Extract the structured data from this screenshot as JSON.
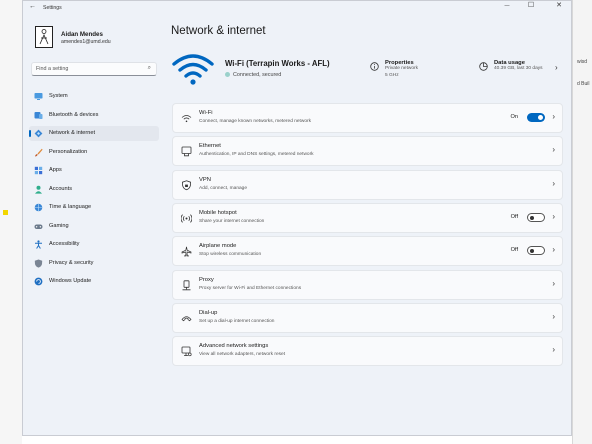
{
  "window": {
    "title": "Settings",
    "back_glyph": "←",
    "minimize_glyph": "—",
    "maximize_glyph": "☐",
    "close_glyph": "✕"
  },
  "profile": {
    "name": "Aidan Mendes",
    "email": "amendes1@umd.edu"
  },
  "search": {
    "placeholder": "Find a setting",
    "value": ""
  },
  "nav": {
    "selected": "Network & internet",
    "items": [
      {
        "label": "System",
        "icon": "monitor-icon"
      },
      {
        "label": "Bluetooth & devices",
        "icon": "bluetooth-devices-icon"
      },
      {
        "label": "Network & internet",
        "icon": "network-diamond-icon"
      },
      {
        "label": "Personalization",
        "icon": "paintbrush-icon"
      },
      {
        "label": "Apps",
        "icon": "apps-grid-icon"
      },
      {
        "label": "Accounts",
        "icon": "person-icon"
      },
      {
        "label": "Time & language",
        "icon": "globe-clock-icon"
      },
      {
        "label": "Gaming",
        "icon": "gamepad-icon"
      },
      {
        "label": "Accessibility",
        "icon": "accessibility-icon"
      },
      {
        "label": "Privacy & security",
        "icon": "shield-icon"
      },
      {
        "label": "Windows Update",
        "icon": "update-icon"
      }
    ]
  },
  "page": {
    "title": "Network & internet"
  },
  "connection": {
    "name": "Wi-Fi (Terrapin Works - AFL)",
    "status": "Connected, secured",
    "properties": {
      "title": "Properties",
      "line1": "Private network",
      "line2": "5 GHz"
    },
    "usage": {
      "title": "Data usage",
      "line1": "40.39 GB, last 30 days"
    }
  },
  "settings": [
    {
      "title": "Wi-Fi",
      "subtitle": "Connect, manage known networks, metered network",
      "icon": "wifi-icon",
      "state": "On",
      "toggle": "on"
    },
    {
      "title": "Ethernet",
      "subtitle": "Authentication, IP and DNS settings, metered network",
      "icon": "ethernet-icon"
    },
    {
      "title": "VPN",
      "subtitle": "Add, connect, manage",
      "icon": "vpn-shield-icon"
    },
    {
      "title": "Mobile hotspot",
      "subtitle": "Share your internet connection",
      "icon": "hotspot-icon",
      "state": "Off",
      "toggle": "off"
    },
    {
      "title": "Airplane mode",
      "subtitle": "Stop wireless communication",
      "icon": "airplane-icon",
      "state": "Off",
      "toggle": "off"
    },
    {
      "title": "Proxy",
      "subtitle": "Proxy server for Wi-Fi and Ethernet connections",
      "icon": "proxy-icon"
    },
    {
      "title": "Dial-up",
      "subtitle": "Set up a dial-up internet connection",
      "icon": "dialup-icon"
    },
    {
      "title": "Advanced network settings",
      "subtitle": "View all network adapters, network reset",
      "icon": "advanced-network-icon"
    }
  ],
  "background_window": {
    "line1": "wisd",
    "line2": "d Buil"
  },
  "colors": {
    "accent": "#0067c0",
    "window_bg": "#eef2f8",
    "card_bg": "#f9fafc"
  }
}
